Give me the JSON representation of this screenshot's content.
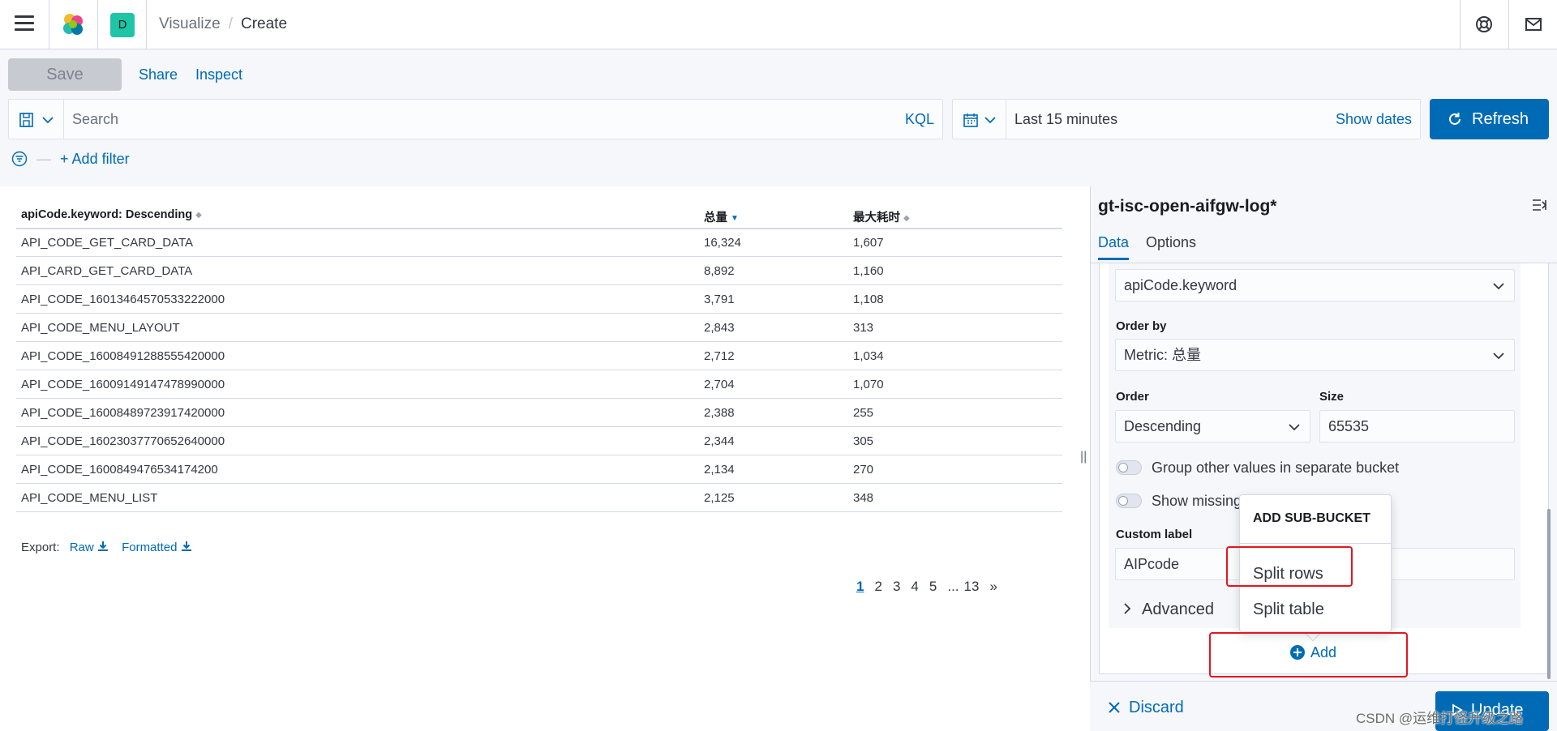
{
  "header": {
    "space_initial": "D",
    "breadcrumbs": [
      "Visualize",
      "Create"
    ]
  },
  "toolbar": {
    "save": "Save",
    "share": "Share",
    "inspect": "Inspect"
  },
  "query": {
    "placeholder": "Search",
    "language": "KQL"
  },
  "time": {
    "value": "Last 15 minutes",
    "show_dates": "Show dates",
    "refresh": "Refresh"
  },
  "filter": {
    "add": "+ Add filter"
  },
  "table": {
    "columns": [
      "apiCode.keyword: Descending",
      "总量",
      "最大耗时"
    ],
    "rows": [
      [
        "API_CODE_GET_CARD_DATA",
        "16,324",
        "1,607"
      ],
      [
        "API_CARD_GET_CARD_DATA",
        "8,892",
        "1,160"
      ],
      [
        "API_CODE_16013464570533222000",
        "3,791",
        "1,108"
      ],
      [
        "API_CODE_MENU_LAYOUT",
        "2,843",
        "313"
      ],
      [
        "API_CODE_16008491288555420000",
        "2,712",
        "1,034"
      ],
      [
        "API_CODE_16009149147478990000",
        "2,704",
        "1,070"
      ],
      [
        "API_CODE_16008489723917420000",
        "2,388",
        "255"
      ],
      [
        "API_CODE_16023037770652640000",
        "2,344",
        "305"
      ],
      [
        "API_CODE_1600849476534174200",
        "2,134",
        "270"
      ],
      [
        "API_CODE_MENU_LIST",
        "2,125",
        "348"
      ]
    ],
    "export_label": "Export:",
    "export_raw": "Raw",
    "export_formatted": "Formatted",
    "pages": [
      "1",
      "2",
      "3",
      "4",
      "5",
      "...",
      "13",
      "»"
    ],
    "current_page": "1"
  },
  "panel": {
    "index_title": "gt-isc-open-aifgw-log*",
    "tabs": [
      "Data",
      "Options"
    ],
    "field_value": "apiCode.keyword",
    "order_by_label": "Order by",
    "order_by_value": "Metric: 总量",
    "order_label": "Order",
    "order_value": "Descending",
    "size_label": "Size",
    "size_value": "65535",
    "toggle_other": "Group other values in separate bucket",
    "toggle_missing": "Show missing",
    "custom_label": "Custom label",
    "custom_label_value": "AIPcode",
    "advanced": "Advanced",
    "add": "Add",
    "discard": "Discard",
    "update": "Update"
  },
  "popover": {
    "title": "ADD SUB-BUCKET",
    "items": [
      "Split rows",
      "Split table"
    ]
  },
  "watermark": "CSDN @运维打怪升级之路",
  "colors": {
    "accent": "#006bb4",
    "highlight": "#e5151f"
  }
}
